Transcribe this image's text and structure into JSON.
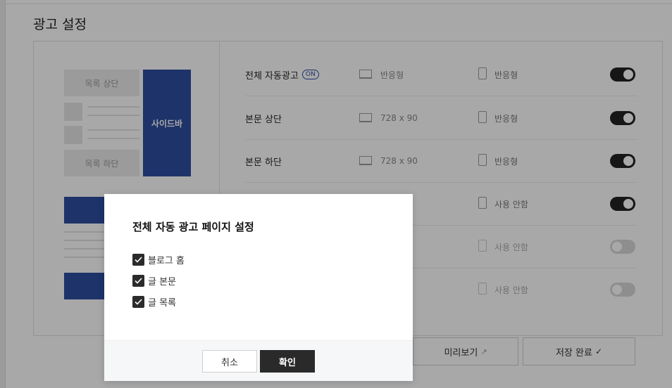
{
  "page": {
    "title": "광고 설정"
  },
  "preview": {
    "list_top_label": "목록 상단",
    "list_bottom_label": "목록 하단",
    "sidebar_label": "사이드바"
  },
  "ad_rows": [
    {
      "label": "전체 자동광고",
      "badge": "ON",
      "pc": "반응형",
      "mobile": "반응형",
      "enabled": true
    },
    {
      "label": "본문 상단",
      "pc": "728 x 90",
      "mobile": "반응형",
      "enabled": true
    },
    {
      "label": "본문 하단",
      "pc": "728 x 90",
      "mobile": "반응형",
      "enabled": true
    },
    {
      "label": "",
      "pc": "",
      "mobile": "사용 안함",
      "enabled": true
    },
    {
      "label": "",
      "pc": "",
      "mobile": "사용 안함",
      "enabled": false
    },
    {
      "label": "",
      "pc": "",
      "mobile": "사용 안함",
      "enabled": false
    }
  ],
  "footer": {
    "preview_label": "미리보기",
    "save_label": "저장 완료"
  },
  "modal": {
    "title": "전체 자동 광고 페이지 설정",
    "options": [
      {
        "label": "블로그 홈",
        "checked": true
      },
      {
        "label": "글 본문",
        "checked": true
      },
      {
        "label": "글 목록",
        "checked": true
      }
    ],
    "cancel_label": "취소",
    "confirm_label": "확인"
  },
  "colors": {
    "accent_blue": "#2d4ea0",
    "dark": "#2a2a2a",
    "toggle_on": "#222222",
    "toggle_off": "#d8d8d8"
  },
  "icons": {
    "preview": "external-link-icon",
    "save": "checkmark-icon",
    "pc": "monitor-icon",
    "mobile": "phone-icon",
    "checkbox": "check-icon"
  }
}
